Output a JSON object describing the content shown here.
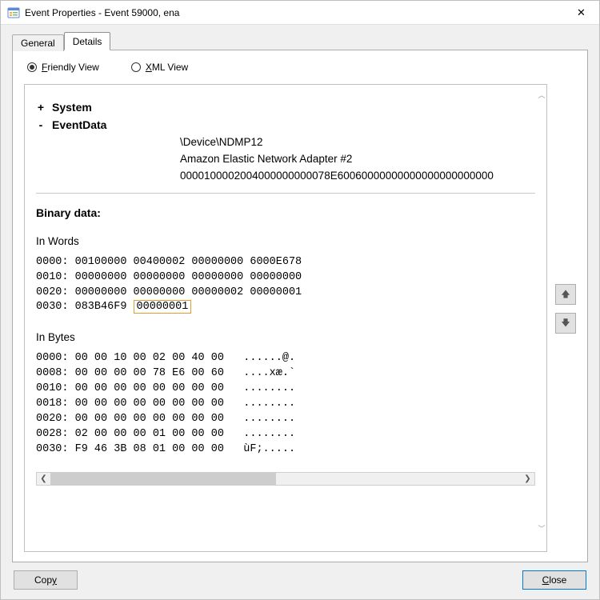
{
  "window": {
    "title": "Event Properties - Event 59000, ena"
  },
  "tabs": {
    "general": "General",
    "details": "Details"
  },
  "radios": {
    "friendly_prefix": "F",
    "friendly_rest": "riendly View",
    "xml_prefix": "X",
    "xml_rest": "ML View"
  },
  "tree": {
    "system_label": "System",
    "eventdata_label": "EventData",
    "rows": {
      "r1": "\\Device\\NDMP12",
      "r2": "Amazon Elastic Network Adapter #2",
      "r3": "0000100002004000000000078E60060000000000000000000000"
    }
  },
  "binary": {
    "section_label": "Binary data:",
    "in_words_label": "In Words",
    "words_pre": "0000: 00100000 00400002 00000000 6000E678\n0010: 00000000 00000000 00000000 00000000\n0020: 00000000 00000000 00000002 00000001",
    "words_last_prefix": "0030: 083B46F9 ",
    "words_last_hl": "00000001",
    "in_bytes_label": "In Bytes",
    "bytes_pre": "0000: 00 00 10 00 02 00 40 00   ......@.\n0008: 00 00 00 00 78 E6 00 60   ....xæ.`\n0010: 00 00 00 00 00 00 00 00   ........\n0018: 00 00 00 00 00 00 00 00   ........\n0020: 00 00 00 00 00 00 00 00   ........\n0028: 02 00 00 00 01 00 00 00   ........\n0030: F9 46 3B 08 01 00 00 00   ùF;....."
  },
  "buttons": {
    "copy_prefix": "Cop",
    "copy_accesskey": "y",
    "close_accesskey": "C",
    "close_rest": "lose"
  }
}
